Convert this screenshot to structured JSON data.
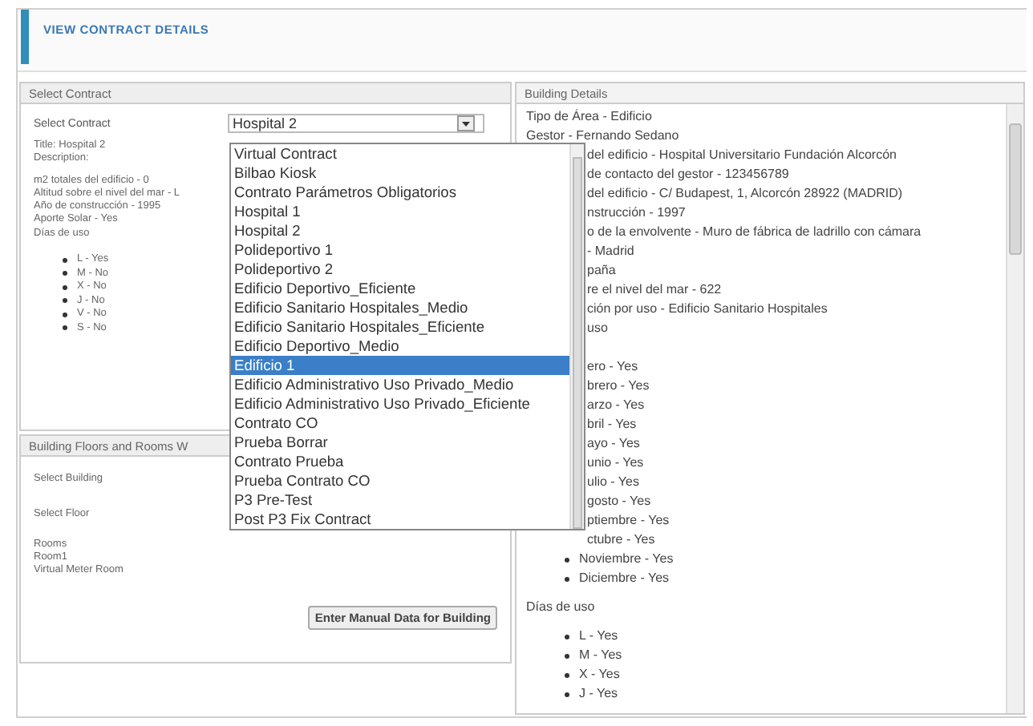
{
  "page_title": "VIEW CONTRACT DETAILS",
  "contract_section": {
    "header": "Select Contract",
    "label": "Select Contract",
    "select_value": "Hospital 2",
    "title_lines": [
      "Title: Hospital 2",
      "Description:"
    ],
    "info_lines": [
      "m2 totales del edificio - 0",
      "Altitud sobre el nivel del mar - L",
      "Año de construcción - 1995",
      "Aporte Solar - Yes",
      "Días de uso"
    ],
    "days": [
      "L - Yes",
      "M - No",
      "X - No",
      "J - No",
      "V - No",
      "S - No"
    ]
  },
  "dropdown": {
    "options": [
      {
        "label": "Virtual Contract",
        "selected": false
      },
      {
        "label": "Bilbao Kiosk",
        "selected": false
      },
      {
        "label": "Contrato Parámetros Obligatorios",
        "selected": false
      },
      {
        "label": "Hospital 1",
        "selected": false
      },
      {
        "label": "Hospital 2",
        "selected": false
      },
      {
        "label": "Polideportivo 1",
        "selected": false
      },
      {
        "label": "Polideportivo 2",
        "selected": false
      },
      {
        "label": "Edificio Deportivo_Eficiente",
        "selected": false
      },
      {
        "label": "Edificio Sanitario Hospitales_Medio",
        "selected": false
      },
      {
        "label": "Edificio Sanitario Hospitales_Eficiente",
        "selected": false
      },
      {
        "label": "Edificio Deportivo_Medio",
        "selected": false
      },
      {
        "label": "Edificio 1",
        "selected": true
      },
      {
        "label": "Edificio Administrativo Uso Privado_Medio",
        "selected": false
      },
      {
        "label": "Edificio Administrativo Uso Privado_Eficiente",
        "selected": false
      },
      {
        "label": "Contrato CO",
        "selected": false
      },
      {
        "label": "Prueba Borrar",
        "selected": false
      },
      {
        "label": "Contrato Prueba",
        "selected": false
      },
      {
        "label": "Prueba Contrato CO",
        "selected": false
      },
      {
        "label": "P3 Pre-Test",
        "selected": false
      },
      {
        "label": "Post P3 Fix Contract",
        "selected": false
      }
    ]
  },
  "rooms_section": {
    "header": "Building Floors and Rooms W",
    "select_building_label": "Select Building",
    "select_floor_label": "Select Floor",
    "rooms": [
      "Rooms",
      "Room1",
      "Virtual Meter Room"
    ],
    "button": "Enter Manual Data for Building"
  },
  "building_details": {
    "header": "Building Details",
    "lines": [
      "Tipo de Área - Edificio",
      "Gestor - Fernando Sedano"
    ],
    "partial_lines": [
      "del edificio - Hospital Universitario Fundación Alcorcón",
      "de contacto del gestor - 123456789",
      "del edificio - C/ Budapest, 1, Alcorcón 28922 (MADRID)",
      "nstrucción - 1997",
      "o de la envolvente - Muro de fábrica de ladrillo con cámara",
      "- Madrid",
      "paña",
      "re el nivel del mar - 622",
      "ción por uso - Edificio Sanitario Hospitales",
      "uso"
    ],
    "month_fragments": [
      "ero - Yes",
      "brero - Yes",
      "arzo - Yes",
      "bril - Yes",
      "ayo - Yes",
      "unio - Yes",
      "ulio - Yes",
      "gosto - Yes",
      "ptiembre - Yes",
      "ctubre - Yes"
    ],
    "months_end": [
      "Noviembre - Yes",
      "Diciembre - Yes"
    ],
    "days_heading": "Días de uso",
    "days": [
      "L - Yes",
      "M - Yes",
      "X - Yes",
      "J - Yes"
    ]
  }
}
